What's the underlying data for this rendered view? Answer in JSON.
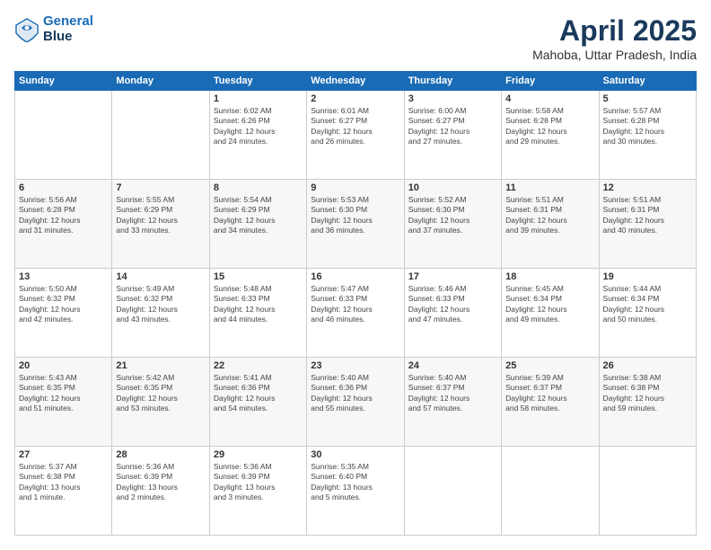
{
  "header": {
    "logo_line1": "General",
    "logo_line2": "Blue",
    "title": "April 2025",
    "subtitle": "Mahoba, Uttar Pradesh, India"
  },
  "calendar": {
    "days": [
      "Sunday",
      "Monday",
      "Tuesday",
      "Wednesday",
      "Thursday",
      "Friday",
      "Saturday"
    ],
    "weeks": [
      [
        {
          "date": "",
          "info": ""
        },
        {
          "date": "",
          "info": ""
        },
        {
          "date": "1",
          "info": "Sunrise: 6:02 AM\nSunset: 6:26 PM\nDaylight: 12 hours\nand 24 minutes."
        },
        {
          "date": "2",
          "info": "Sunrise: 6:01 AM\nSunset: 6:27 PM\nDaylight: 12 hours\nand 26 minutes."
        },
        {
          "date": "3",
          "info": "Sunrise: 6:00 AM\nSunset: 6:27 PM\nDaylight: 12 hours\nand 27 minutes."
        },
        {
          "date": "4",
          "info": "Sunrise: 5:58 AM\nSunset: 6:28 PM\nDaylight: 12 hours\nand 29 minutes."
        },
        {
          "date": "5",
          "info": "Sunrise: 5:57 AM\nSunset: 6:28 PM\nDaylight: 12 hours\nand 30 minutes."
        }
      ],
      [
        {
          "date": "6",
          "info": "Sunrise: 5:56 AM\nSunset: 6:28 PM\nDaylight: 12 hours\nand 31 minutes."
        },
        {
          "date": "7",
          "info": "Sunrise: 5:55 AM\nSunset: 6:29 PM\nDaylight: 12 hours\nand 33 minutes."
        },
        {
          "date": "8",
          "info": "Sunrise: 5:54 AM\nSunset: 6:29 PM\nDaylight: 12 hours\nand 34 minutes."
        },
        {
          "date": "9",
          "info": "Sunrise: 5:53 AM\nSunset: 6:30 PM\nDaylight: 12 hours\nand 36 minutes."
        },
        {
          "date": "10",
          "info": "Sunrise: 5:52 AM\nSunset: 6:30 PM\nDaylight: 12 hours\nand 37 minutes."
        },
        {
          "date": "11",
          "info": "Sunrise: 5:51 AM\nSunset: 6:31 PM\nDaylight: 12 hours\nand 39 minutes."
        },
        {
          "date": "12",
          "info": "Sunrise: 5:51 AM\nSunset: 6:31 PM\nDaylight: 12 hours\nand 40 minutes."
        }
      ],
      [
        {
          "date": "13",
          "info": "Sunrise: 5:50 AM\nSunset: 6:32 PM\nDaylight: 12 hours\nand 42 minutes."
        },
        {
          "date": "14",
          "info": "Sunrise: 5:49 AM\nSunset: 6:32 PM\nDaylight: 12 hours\nand 43 minutes."
        },
        {
          "date": "15",
          "info": "Sunrise: 5:48 AM\nSunset: 6:33 PM\nDaylight: 12 hours\nand 44 minutes."
        },
        {
          "date": "16",
          "info": "Sunrise: 5:47 AM\nSunset: 6:33 PM\nDaylight: 12 hours\nand 46 minutes."
        },
        {
          "date": "17",
          "info": "Sunrise: 5:46 AM\nSunset: 6:33 PM\nDaylight: 12 hours\nand 47 minutes."
        },
        {
          "date": "18",
          "info": "Sunrise: 5:45 AM\nSunset: 6:34 PM\nDaylight: 12 hours\nand 49 minutes."
        },
        {
          "date": "19",
          "info": "Sunrise: 5:44 AM\nSunset: 6:34 PM\nDaylight: 12 hours\nand 50 minutes."
        }
      ],
      [
        {
          "date": "20",
          "info": "Sunrise: 5:43 AM\nSunset: 6:35 PM\nDaylight: 12 hours\nand 51 minutes."
        },
        {
          "date": "21",
          "info": "Sunrise: 5:42 AM\nSunset: 6:35 PM\nDaylight: 12 hours\nand 53 minutes."
        },
        {
          "date": "22",
          "info": "Sunrise: 5:41 AM\nSunset: 6:36 PM\nDaylight: 12 hours\nand 54 minutes."
        },
        {
          "date": "23",
          "info": "Sunrise: 5:40 AM\nSunset: 6:36 PM\nDaylight: 12 hours\nand 55 minutes."
        },
        {
          "date": "24",
          "info": "Sunrise: 5:40 AM\nSunset: 6:37 PM\nDaylight: 12 hours\nand 57 minutes."
        },
        {
          "date": "25",
          "info": "Sunrise: 5:39 AM\nSunset: 6:37 PM\nDaylight: 12 hours\nand 58 minutes."
        },
        {
          "date": "26",
          "info": "Sunrise: 5:38 AM\nSunset: 6:38 PM\nDaylight: 12 hours\nand 59 minutes."
        }
      ],
      [
        {
          "date": "27",
          "info": "Sunrise: 5:37 AM\nSunset: 6:38 PM\nDaylight: 13 hours\nand 1 minute."
        },
        {
          "date": "28",
          "info": "Sunrise: 5:36 AM\nSunset: 6:39 PM\nDaylight: 13 hours\nand 2 minutes."
        },
        {
          "date": "29",
          "info": "Sunrise: 5:36 AM\nSunset: 6:39 PM\nDaylight: 13 hours\nand 3 minutes."
        },
        {
          "date": "30",
          "info": "Sunrise: 5:35 AM\nSunset: 6:40 PM\nDaylight: 13 hours\nand 5 minutes."
        },
        {
          "date": "",
          "info": ""
        },
        {
          "date": "",
          "info": ""
        },
        {
          "date": "",
          "info": ""
        }
      ]
    ]
  }
}
